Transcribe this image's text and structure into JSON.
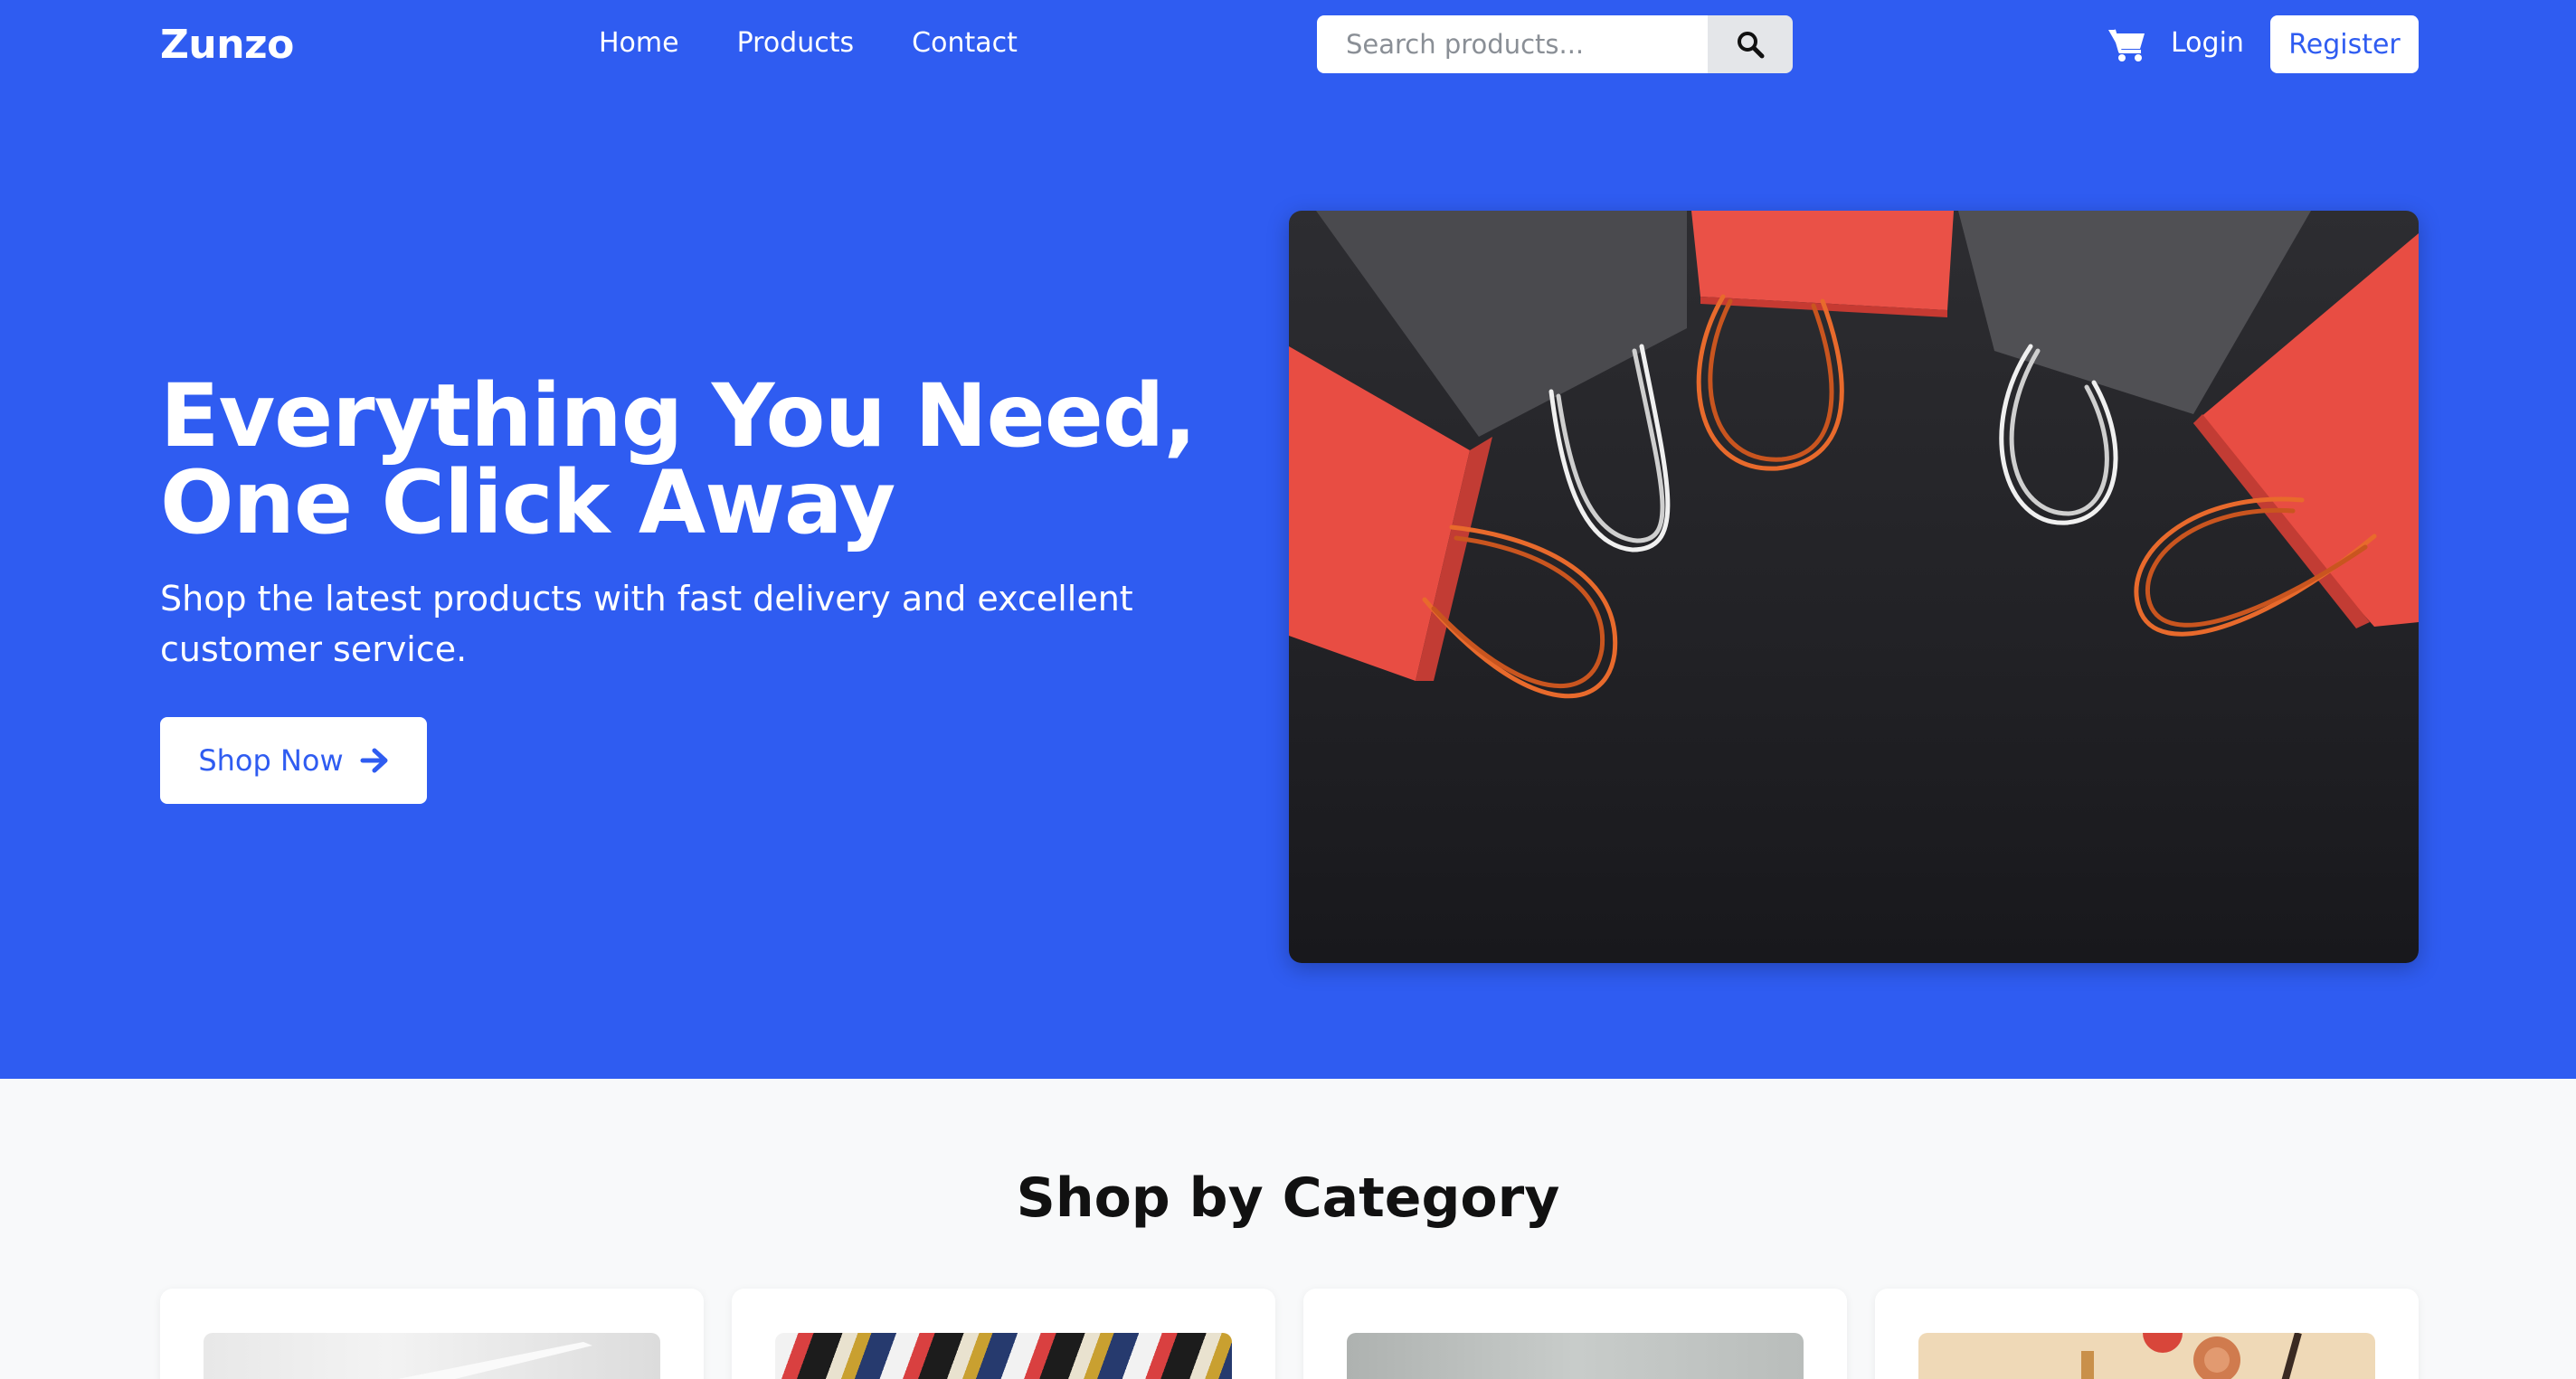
{
  "brand": "Zunzo",
  "nav": {
    "links": [
      "Home",
      "Products",
      "Contact"
    ],
    "search_placeholder": "Search products...",
    "login": "Login",
    "register": "Register"
  },
  "hero": {
    "title": "Everything You Need, One Click Away",
    "subtitle": "Shop the latest products with fast delivery and excellent customer service.",
    "cta": "Shop Now"
  },
  "categories": {
    "title": "Shop by Category"
  },
  "colors": {
    "primary": "#2f5cf1",
    "background": "#f8f9fa"
  }
}
